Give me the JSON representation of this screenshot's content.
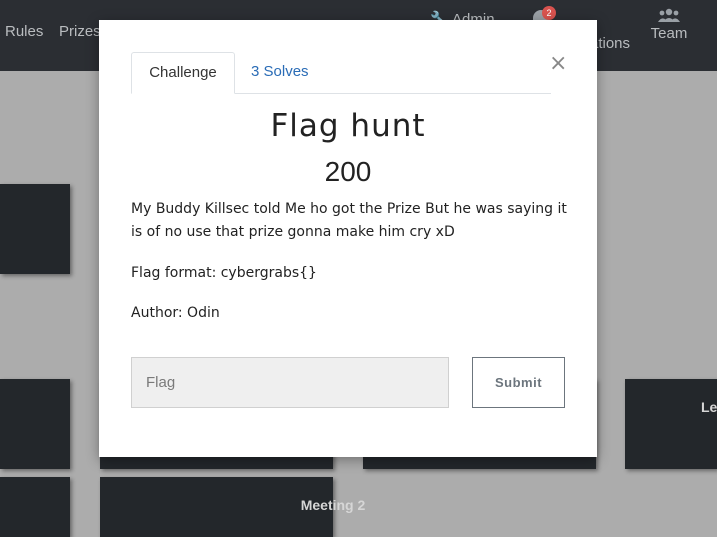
{
  "navbar": {
    "rules": "Rules",
    "prizes": "Prizes",
    "admin": "Admin",
    "notifications_count": "2",
    "notifications": "ations",
    "team": "Team"
  },
  "cards": {
    "bottom_right_label": "Le",
    "meeting_label": "Meeting 2"
  },
  "modal": {
    "tabs": [
      "Challenge",
      "3 Solves"
    ],
    "active_tab": "Challenge",
    "title": "Flag hunt",
    "value": "200",
    "description": "My Buddy Killsec told Me ho got the Prize But he was saying it is of no use that prize gonna make him cry xD",
    "flag_format": "Flag format: cybergrabs{}",
    "author": "Author: Odin",
    "flag_placeholder": "Flag",
    "flag_value": "",
    "submit_label": "Submit",
    "close_symbol": "×"
  },
  "colors": {
    "navbar_bg": "#2b2e33",
    "backdrop": "#acacac",
    "card_bg": "#23272b",
    "link": "#2a6cb6",
    "badge": "#d9534f"
  },
  "icons": [
    "wrench-icon",
    "bell-icon",
    "users-icon",
    "close-icon"
  ]
}
